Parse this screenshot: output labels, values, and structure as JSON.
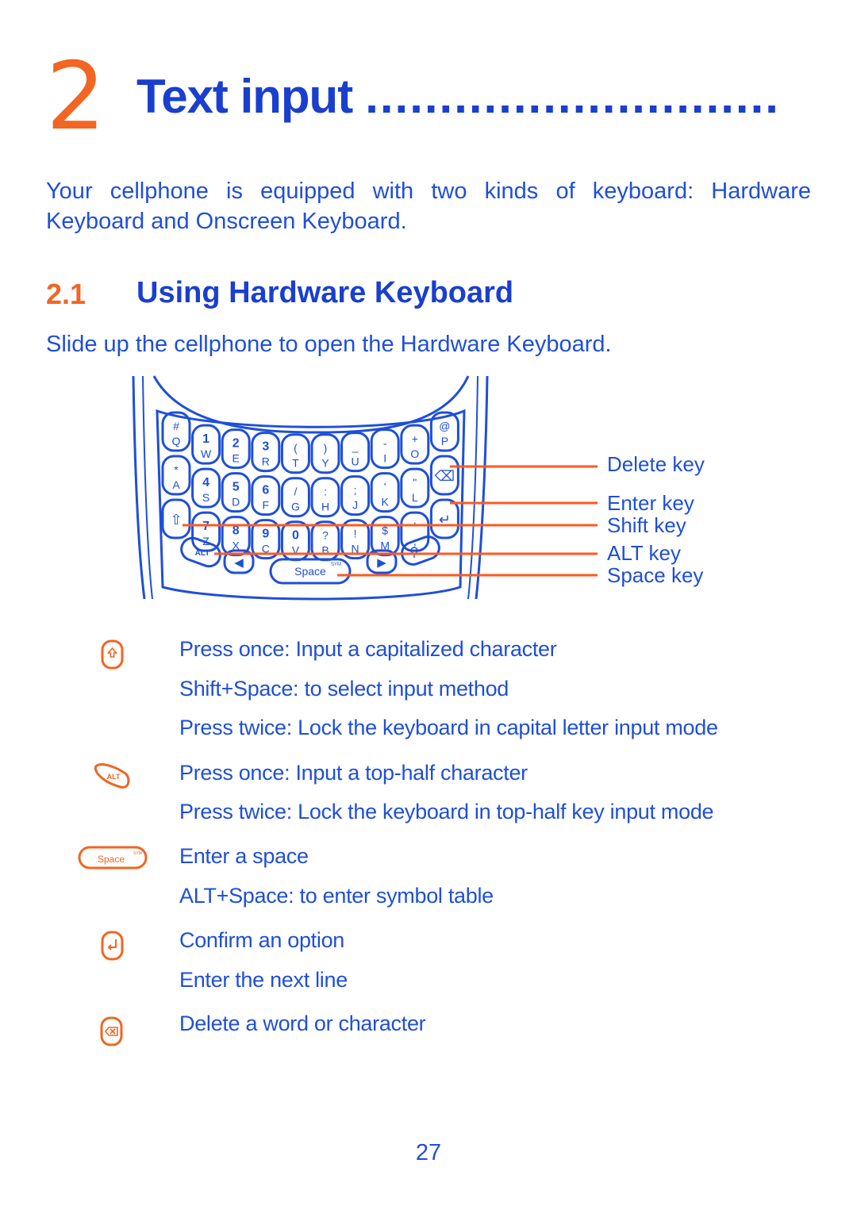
{
  "chapter": {
    "number": "2",
    "title": "Text input",
    "leader": "............................"
  },
  "intro": "Your cellphone is equipped with two kinds of keyboard: Hardware Keyboard and Onscreen Keyboard.",
  "section": {
    "number": "2.1",
    "title": "Using Hardware Keyboard",
    "lead": "Slide up the cellphone to open the Hardware Keyboard."
  },
  "figure": {
    "rows": [
      [
        [
          "Q",
          "#"
        ],
        [
          "W",
          "1"
        ],
        [
          "E",
          "2"
        ],
        [
          "R",
          "3"
        ],
        [
          "T",
          "("
        ],
        [
          "Y",
          ")"
        ],
        [
          "U",
          "_"
        ],
        [
          "I",
          "-"
        ],
        [
          "O",
          "+"
        ],
        [
          "P",
          "@"
        ]
      ],
      [
        [
          "A",
          "*"
        ],
        [
          "S",
          "4"
        ],
        [
          "D",
          "5"
        ],
        [
          "F",
          "6"
        ],
        [
          "G",
          "/"
        ],
        [
          "H",
          ":"
        ],
        [
          "J",
          ";"
        ],
        [
          "K",
          "'"
        ],
        [
          "L",
          "\""
        ],
        [
          "⌫",
          ""
        ]
      ],
      [
        [
          "⇧",
          ""
        ],
        [
          "Z",
          "7"
        ],
        [
          "X",
          "8"
        ],
        [
          "C",
          "9"
        ],
        [
          "V",
          "0"
        ],
        [
          "B",
          "?"
        ],
        [
          "N",
          "!"
        ],
        [
          "M",
          "$"
        ],
        [
          ",",
          "'"
        ],
        [
          "↵",
          ""
        ]
      ]
    ],
    "bottom": {
      "alt": "ALT",
      "left": "◀",
      "space": "Space",
      "sym": "SYM",
      "right": "▶",
      "search": "⚲"
    },
    "callouts": [
      "Delete key",
      "Enter key",
      "Shift key",
      "ALT key",
      "Space key"
    ],
    "line_color": "#ff5a1f",
    "ink_color": "#1f4fd8"
  },
  "keys": [
    {
      "icon": "shift-key-icon",
      "lines": [
        "Press once: Input a capitalized character",
        "Shift+Space: to select input method",
        "Press twice: Lock the keyboard in capital letter input mode"
      ]
    },
    {
      "icon": "alt-key-icon",
      "label": "ALT",
      "lines": [
        "Press once: Input a top-half character",
        "Press twice: Lock the keyboard in top-half key input mode"
      ]
    },
    {
      "icon": "space-key-icon",
      "label": "Space",
      "sym": "SYM",
      "lines": [
        "Enter a space",
        "ALT+Space: to enter symbol table"
      ]
    },
    {
      "icon": "enter-key-icon",
      "lines": [
        "Confirm an option",
        "Enter the next line"
      ]
    },
    {
      "icon": "delete-key-icon",
      "lines": [
        "Delete a word or character"
      ]
    }
  ],
  "page_number": "27"
}
